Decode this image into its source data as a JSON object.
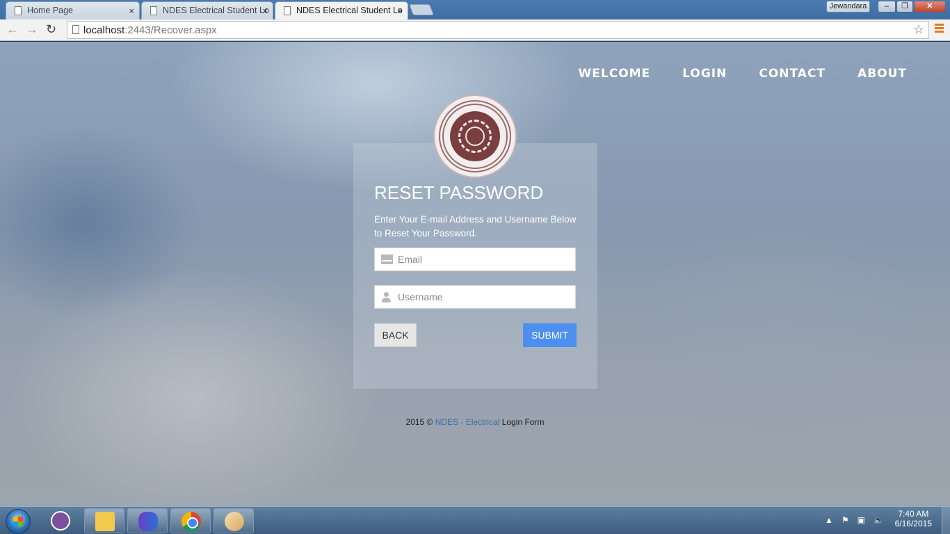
{
  "browser": {
    "tabs": [
      {
        "title": "Home Page",
        "active": false
      },
      {
        "title": "NDES Electrical Student Lo",
        "active": false
      },
      {
        "title": "NDES Electrical Student Lo",
        "active": true
      }
    ],
    "profile_name": "Jewandara",
    "url_host": "localhost",
    "url_path": ":2443/Recover.aspx",
    "close_glyph": "×"
  },
  "nav": {
    "items": [
      "WELCOME",
      "LOGIN",
      "CONTACT",
      "ABOUT"
    ]
  },
  "form": {
    "title": "RESET PASSWORD",
    "description": "Enter Your E-mail Address and Username Below to Reset Your Password.",
    "email_placeholder": "Email",
    "username_placeholder": "Username",
    "back_label": "BACK",
    "submit_label": "SUBMIT",
    "submit_color": "#4d8ff0"
  },
  "footer": {
    "prefix": "2015 © ",
    "brand": "NDES - Electrical",
    "suffix": " Login Form"
  },
  "taskbar": {
    "apps": [
      "viber-icon",
      "folder-icon",
      "visual-studio-icon",
      "chrome-icon",
      "paint-icon"
    ],
    "time": "7:40 AM",
    "date": "6/16/2015"
  }
}
